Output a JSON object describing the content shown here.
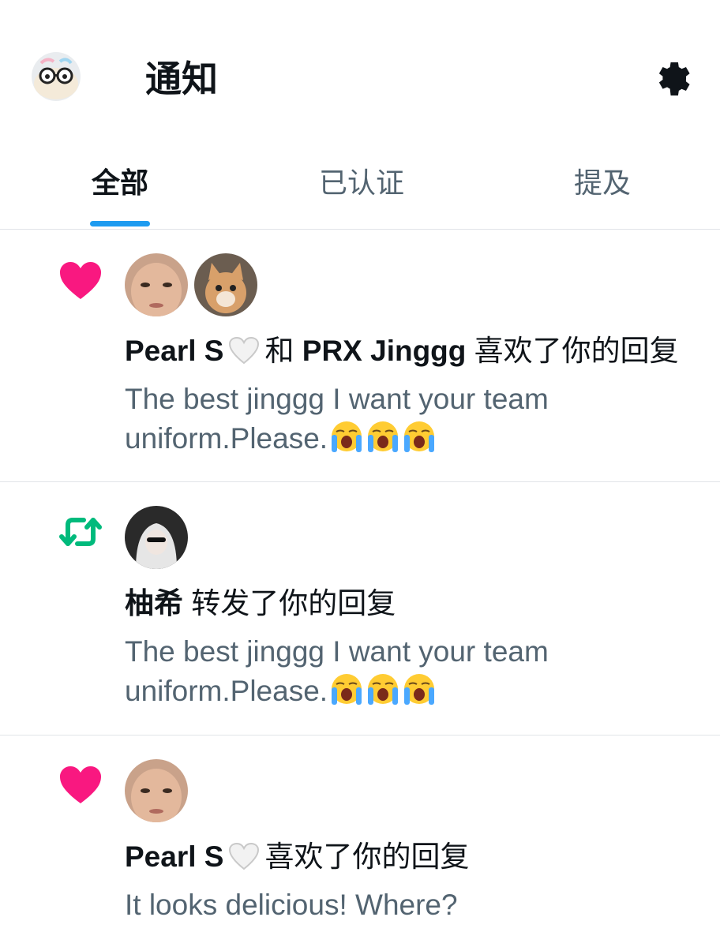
{
  "header": {
    "title": "通知",
    "avatar_icon": "user-avatar",
    "settings_icon": "gear-icon"
  },
  "tabs": [
    {
      "label": "全部",
      "active": true
    },
    {
      "label": "已认证",
      "active": false
    },
    {
      "label": "提及",
      "active": false
    }
  ],
  "accent_color": "#1d9bf0",
  "like_color": "#f91880",
  "retweet_color": "#00ba7c",
  "notifications": [
    {
      "type": "like",
      "icon": "heart-icon",
      "user1": "Pearl S",
      "user1_badge": "white-heart-icon",
      "connector": "和",
      "user2": "PRX Jinggg",
      "action": "喜欢了你的回复",
      "text": "The best jinggg I want your team uniform.Please.",
      "emoji": [
        "loudly-crying-face",
        "loudly-crying-face",
        "loudly-crying-face"
      ]
    },
    {
      "type": "retweet",
      "icon": "retweet-icon",
      "user1": "柚希",
      "action": "转发了你的回复",
      "text": "The best jinggg I want your team uniform.Please.",
      "emoji": [
        "loudly-crying-face",
        "loudly-crying-face",
        "loudly-crying-face"
      ]
    },
    {
      "type": "like",
      "icon": "heart-icon",
      "user1": "Pearl S",
      "user1_badge": "white-heart-icon",
      "action": "喜欢了你的回复",
      "text": "It looks delicious! Where?"
    }
  ]
}
